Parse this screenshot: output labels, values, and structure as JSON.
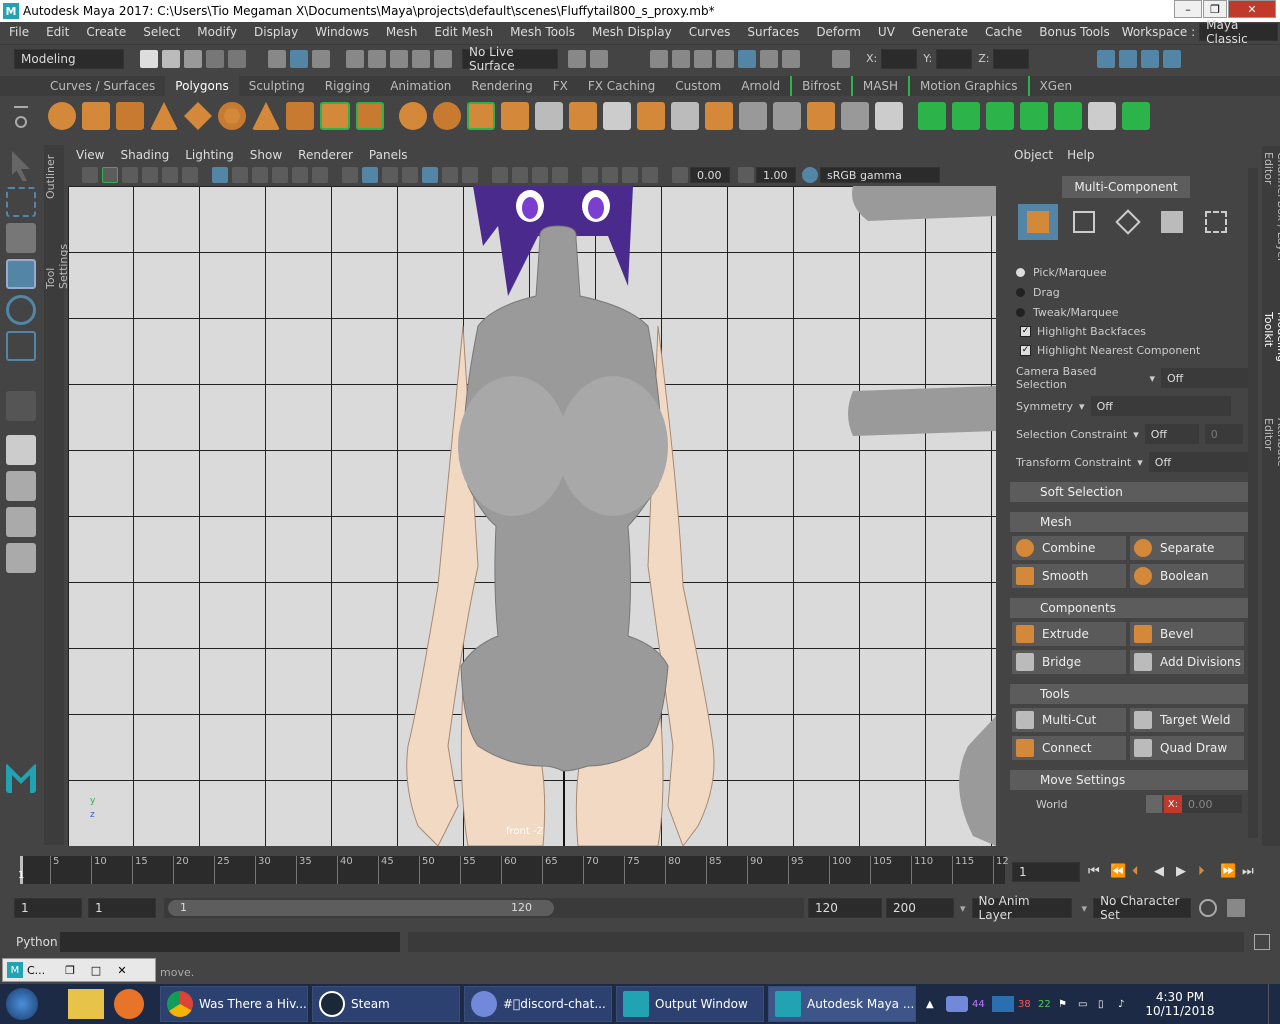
{
  "window": {
    "title": "Autodesk Maya 2017: C:\\Users\\Tio Megaman X\\Documents\\Maya\\projects\\default\\scenes\\Fluffytail800_s_proxy.mb*",
    "min": "–",
    "max": "❐",
    "close": "✕"
  },
  "menus": [
    "File",
    "Edit",
    "Create",
    "Select",
    "Modify",
    "Display",
    "Windows",
    "Mesh",
    "Edit Mesh",
    "Mesh Tools",
    "Mesh Display",
    "Curves",
    "Surfaces",
    "Deform",
    "UV",
    "Generate",
    "Cache",
    "Bonus Tools"
  ],
  "workspace": {
    "label": "Workspace :",
    "value": "Maya Classic"
  },
  "status": {
    "menuset": "Modeling",
    "live_surface": "No Live Surface",
    "x": "X:",
    "y": "Y:",
    "z": "Z:"
  },
  "shelf_tabs": [
    "Curves / Surfaces",
    "Polygons",
    "Sculpting",
    "Rigging",
    "Animation",
    "Rendering",
    "FX",
    "FX Caching",
    "Custom",
    "Arnold",
    "Bifrost",
    "MASH",
    "Motion Graphics",
    "XGen"
  ],
  "shelf_active": "Polygons",
  "side_tabs": [
    "Outliner",
    "Tool Settings"
  ],
  "panel_menus": [
    "View",
    "Shading",
    "Lighting",
    "Show",
    "Renderer",
    "Panels"
  ],
  "panel": {
    "exposure": "0.00",
    "gamma": "1.00",
    "colorspace": "sRGB gamma"
  },
  "viewport": {
    "camera_label": "front -Z",
    "axis_y": "y",
    "axis_z": "z"
  },
  "toolkit": {
    "menu_object": "Object",
    "menu_help": "Help",
    "mode": "Multi-Component",
    "pick": "Pick/Marquee",
    "drag": "Drag",
    "tweak": "Tweak/Marquee",
    "hl_back": "Highlight Backfaces",
    "hl_near": "Highlight Nearest Component",
    "camsel_label": "Camera Based Selection",
    "camsel_val": "Off",
    "sym_label": "Symmetry",
    "sym_val": "Off",
    "selc_label": "Selection Constraint",
    "selc_val": "Off",
    "selc_num": "0",
    "trc_label": "Transform Constraint",
    "trc_val": "Off",
    "soft": "Soft Selection",
    "mesh": "Mesh",
    "combine": "Combine",
    "separate": "Separate",
    "smooth": "Smooth",
    "boolean": "Boolean",
    "components": "Components",
    "extrude": "Extrude",
    "bevel": "Bevel",
    "bridge": "Bridge",
    "add_div": "Add Divisions",
    "tools": "Tools",
    "multicut": "Multi-Cut",
    "target_weld": "Target Weld",
    "connect": "Connect",
    "quad_draw": "Quad Draw",
    "move": "Move Settings",
    "world": "World",
    "xlab": "X:",
    "xval": "0.00"
  },
  "right_tabs": [
    "Channel Box / Layer Editor",
    "Modeling Toolkit",
    "Attribute Editor"
  ],
  "timeline": {
    "ticks": [
      "5",
      "10",
      "15",
      "20",
      "25",
      "30",
      "35",
      "40",
      "45",
      "50",
      "55",
      "60",
      "65",
      "70",
      "75",
      "80",
      "85",
      "90",
      "95",
      "100",
      "105",
      "110",
      "115",
      "12"
    ],
    "first": "1",
    "current": "1"
  },
  "range": {
    "start": "1",
    "start2": "1",
    "bar_start": "1",
    "bar_end": "120",
    "end": "120",
    "end2": "200",
    "anim_layer": "No Anim Layer",
    "char_set": "No Character Set"
  },
  "cmd": {
    "lang": "Python"
  },
  "help": {
    "text": "move.",
    "mini_title": "C..."
  },
  "taskbar": {
    "items": [
      "Was There a Hiv...",
      "Steam",
      "#\u0000discord-chat...",
      "Output Window",
      "Autodesk Maya ..."
    ],
    "time": "4:30 PM",
    "date": "10/11/2018",
    "n1": "44",
    "n2": "38",
    "n3": "22"
  },
  "colors": {
    "accent": "#5285a6",
    "orange": "#d4883a",
    "green": "#2cb34a",
    "bg": "#444444"
  }
}
